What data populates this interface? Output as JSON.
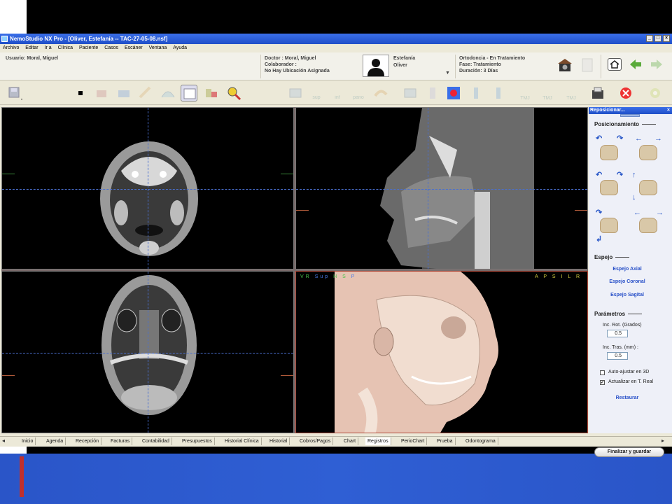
{
  "window": {
    "title": "NemoStudio NX Pro - [Oliver, Estefanía  -- TAC-27-05-08.nsf]"
  },
  "menu": [
    "Archivo",
    "Editar",
    "Ir a",
    "Clínica",
    "Paciente",
    "Casos",
    "Escáner",
    "Ventana",
    "Ayuda"
  ],
  "info": {
    "usuario": "Usuario: Moral, Miguel",
    "doctor": "Doctor : Moral, Miguel",
    "colaborador": "Colaborador :",
    "ubicacion": "No Hay Ubicación Asignada",
    "patient_first": "Estefanía",
    "patient_last": "Oliver",
    "tratamiento": "Ortodoncia - En Tratamiento",
    "fase": "Fase: Tratamiento",
    "duracion": "Duración: 3 Días"
  },
  "toolbar": {
    "sup": "sup",
    "inf": "inf",
    "pano": "pano",
    "tmj": "TMJ"
  },
  "view3d": {
    "left_labels": [
      "VR",
      "Sup",
      "H",
      "S",
      "P"
    ],
    "right_labels": [
      "A",
      "P",
      "S",
      "I",
      "L",
      "R"
    ]
  },
  "panel": {
    "title": "Reposicionar...",
    "posicionamiento": "Posicionamiento",
    "espejo": "Espejo",
    "espejo_axial": "Espejo Axial",
    "espejo_coronal": "Espejo Coronal",
    "espejo_sagital": "Espejo Sagital",
    "parametros": "Parámetros",
    "inc_rot_label": "Inc. Rot. (Grados)",
    "inc_rot_value": "0.5",
    "inc_tras_label": "Inc. Tras. (mm) :",
    "inc_tras_value": "0.5",
    "auto_ajustar": "Auto-ajustar en 3D",
    "auto_ajustar_checked": false,
    "actualizar": "Actualizar en T. Real",
    "actualizar_checked": true,
    "restaurar": "Restaurar",
    "finalizar": "Finalizar y guardar"
  },
  "tabs": [
    {
      "label": "Inicio"
    },
    {
      "label": "Agenda"
    },
    {
      "label": "Recepción"
    },
    {
      "label": "Facturas"
    },
    {
      "label": "Contabilidad"
    },
    {
      "label": "Presupuestos"
    },
    {
      "label": "Historial Clínica"
    },
    {
      "label": "Historial"
    },
    {
      "label": "Cobros/Pagos"
    },
    {
      "label": "Chart"
    },
    {
      "label": "Registros",
      "active": true
    },
    {
      "label": "PerioChart"
    },
    {
      "label": "Prueba"
    },
    {
      "label": "Odontograma"
    }
  ],
  "colors": {
    "titlebar": "#2a5ed8",
    "slide_blue": "#2f5fd4",
    "accent_red": "#c0302e",
    "link_blue": "#2850c8"
  }
}
